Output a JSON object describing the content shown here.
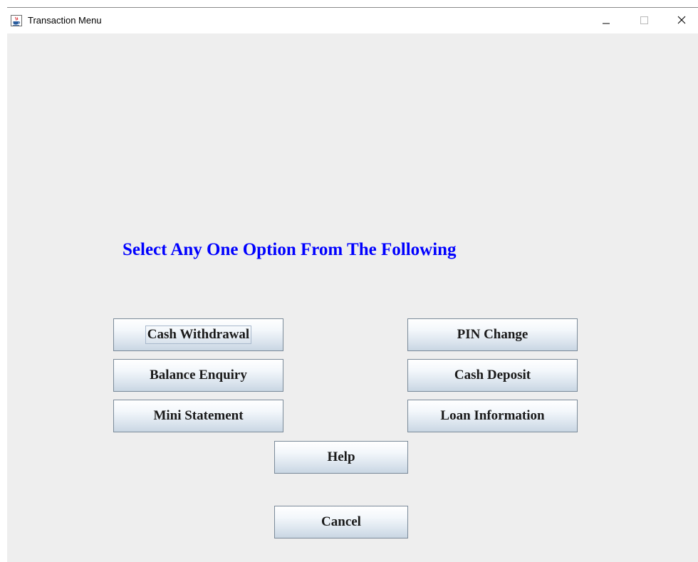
{
  "window": {
    "title": "Transaction Menu",
    "icon": "java-cup-icon",
    "controls": {
      "minimize_icon": "minimize-icon",
      "maximize_icon": "maximize-icon",
      "close_icon": "close-icon"
    }
  },
  "main": {
    "heading": "Select Any One Option From The Following",
    "heading_color": "#0000ff",
    "background_color": "#eeeeee",
    "buttons": {
      "cash_withdrawal": "Cash Withdrawal",
      "balance_enquiry": "Balance Enquiry",
      "mini_statement": "Mini Statement",
      "pin_change": "PIN Change",
      "cash_deposit": "Cash Deposit",
      "loan_information": "Loan Information",
      "help": "Help",
      "cancel": "Cancel"
    },
    "focused_button": "Cash Withdrawal"
  }
}
